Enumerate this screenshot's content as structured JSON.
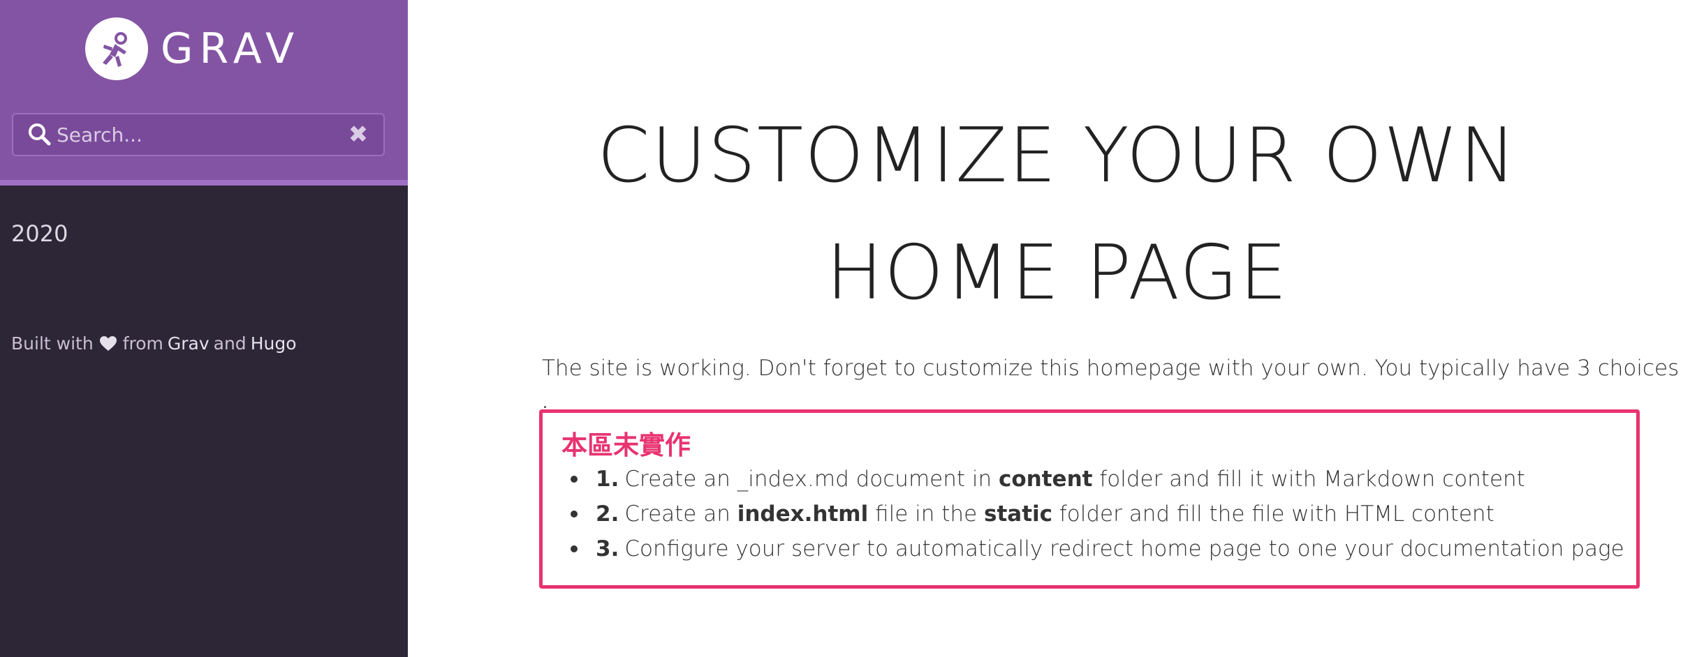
{
  "sidebar": {
    "logo_text": "GRAV",
    "search": {
      "placeholder": "Search...",
      "value": ""
    },
    "year": "2020",
    "footer": {
      "prefix": "Built with",
      "middle": "from",
      "link1": "Grav",
      "joiner": "and",
      "link2": "Hugo"
    }
  },
  "main": {
    "title": "CUSTOMIZE YOUR OWN HOME PAGE",
    "intro": "The site is working. Don't forget to customize this homepage with your own. You typically have 3 choices",
    "stray_mark": ".",
    "annotation_label": "本區未實作",
    "choices": [
      {
        "num": "1.",
        "t1": "Create an _index.md document in",
        "b1": "content",
        "t2": "folder and fill it with Markdown content"
      },
      {
        "num": "2.",
        "t1": "Create an",
        "b1": "index.html",
        "t2": "file in the",
        "b2": "static",
        "t3": "folder and fill the file with HTML content"
      },
      {
        "num": "3.",
        "t1": "Configure your server to automatically redirect home page to one your documentation page"
      }
    ]
  },
  "colors": {
    "sidebar_header": "#8454a4",
    "sidebar_bg": "#2d2637",
    "annotation": "#e8336f"
  },
  "icons": [
    "astronaut-logo-icon",
    "search-icon",
    "clear-icon",
    "heart-icon"
  ]
}
